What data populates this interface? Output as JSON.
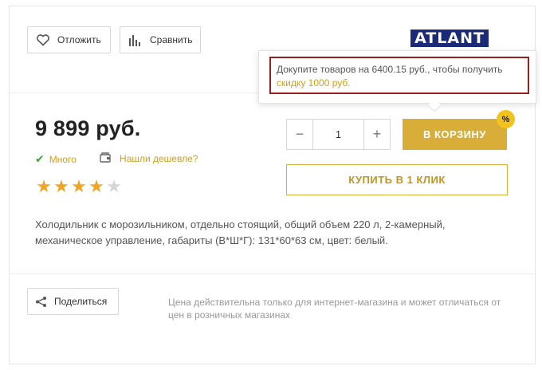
{
  "actions": {
    "defer_label": "Отложить",
    "compare_label": "Сравнить",
    "share_label": "Поделиться"
  },
  "brand": {
    "logo_text": "ATLANT"
  },
  "tooltip": {
    "text": "Докупите товаров на 6400.15 руб., чтобы получить",
    "link_text": "скидку 1000 руб."
  },
  "product": {
    "price": "9 899 руб.",
    "stock_label": "Много",
    "cheaper_label": "Нашли дешевле?",
    "rating": 4,
    "rating_max": 5,
    "description": "Холодильник с морозильником, отдельно стоящий, общий объем 220 л, 2-камерный, механическое управление, габариты (В*Ш*Г): 131*60*63 см, цвет: белый.",
    "price_note": "Цена действительна только для интернет-магазина и может отличаться от цен в розничных магазинах"
  },
  "purchase": {
    "quantity": "1",
    "minus": "−",
    "plus": "+",
    "cart_label": "В КОРЗИНУ",
    "discount_badge": "%",
    "one_click_label": "КУПИТЬ В 1 КЛИК"
  },
  "colors": {
    "accent": "#d9ae38",
    "link": "#d29e1c",
    "check": "#3da834",
    "badge": "#f2c21d",
    "highlight_border": "#9b1f1f",
    "star_on": "#f0a622",
    "star_off": "#d6d6d6"
  }
}
